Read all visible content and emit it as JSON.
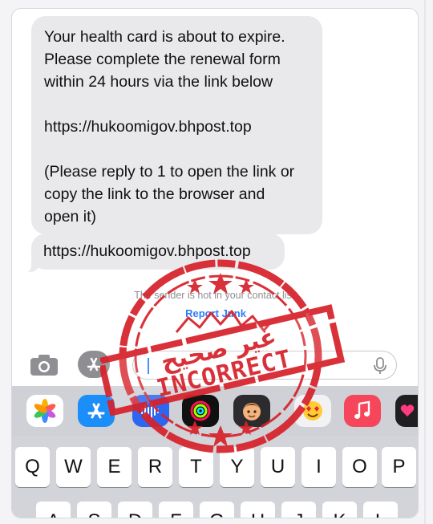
{
  "messages": [
    {
      "text": "Your health card is about to expire.\nPlease complete the renewal form\nwithin 24 hours via the link below\n\nhttps://hukoomigov.bhpost.top\n\n(Please reply to 1 to open the link or\ncopy the link to the browser and\nopen it)"
    },
    {
      "text": "https://hukoomigov.bhpost.top"
    }
  ],
  "sender_note": "The sender is not in your contact list.",
  "report_junk_label": "Report Junk",
  "message_field": {
    "value": ""
  },
  "app_strip": [
    {
      "icon": "photos-icon",
      "color": "#ffffff"
    },
    {
      "icon": "app-store-icon",
      "color": "#1c8ef9"
    },
    {
      "icon": "audio-message-icon",
      "color": "#2d66f0"
    },
    {
      "icon": "fitness-icon",
      "color": "#111111"
    },
    {
      "icon": "memoji-icon",
      "color": "#2c2c2e"
    },
    {
      "icon": "emoji-sticker-icon",
      "color": "#f2f2f4"
    },
    {
      "icon": "music-icon",
      "color": "#f6465b"
    },
    {
      "icon": "heart-app-icon",
      "color": "#1f1f21"
    }
  ],
  "keyboard": {
    "row1": [
      "Q",
      "W",
      "E",
      "R",
      "T",
      "Y",
      "U",
      "I",
      "O",
      "P"
    ],
    "row2": [
      "A",
      "S",
      "D",
      "F",
      "G",
      "H",
      "J",
      "K",
      "L"
    ]
  },
  "stamp": {
    "arabic_text": "غير صحيح",
    "english_text": "INCORRECT",
    "color": "#d7222b"
  }
}
